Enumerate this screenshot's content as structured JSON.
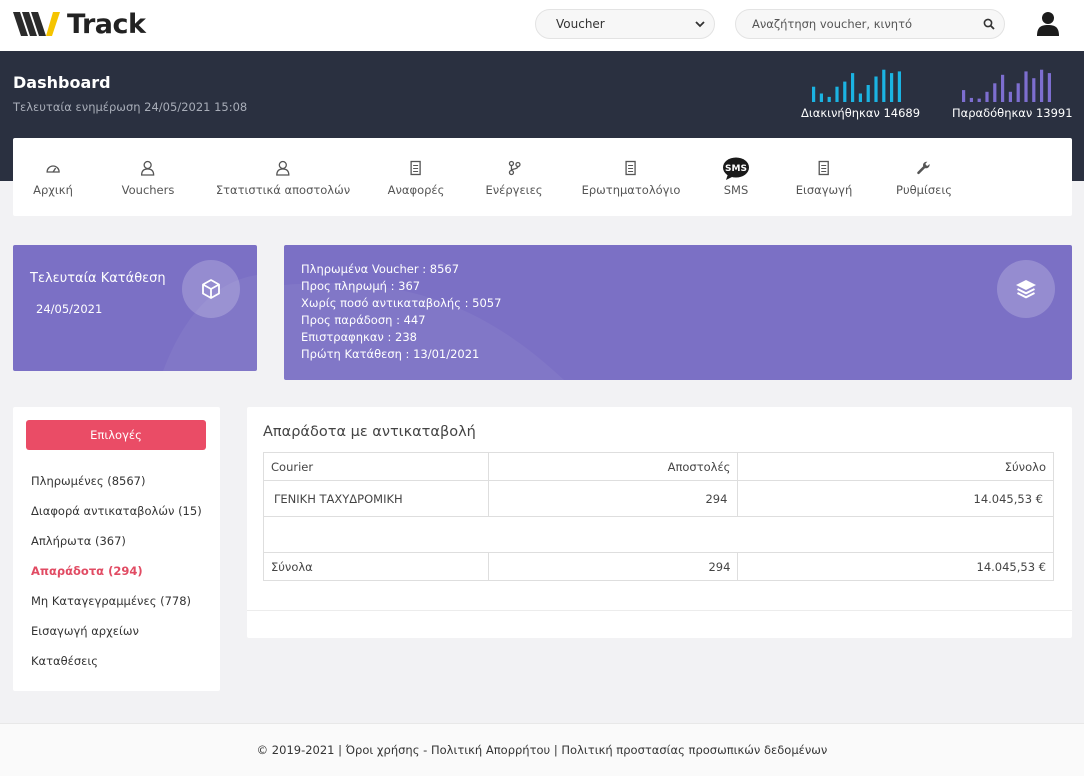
{
  "app": {
    "logo_text": "Track"
  },
  "topbar": {
    "voucher_select": "Voucher",
    "search_placeholder": "Αναζήτηση voucher, κινητό"
  },
  "header": {
    "title": "Dashboard",
    "subtitle": "Τελευταία ενημέρωση 24/05/2021 15:08",
    "moved": {
      "label": "Διακινήθηκαν",
      "value": "14689",
      "color": "#1bb3e2"
    },
    "delivered": {
      "label": "Παραδόθηκαν",
      "value": "13991",
      "color": "#7d6ed0"
    }
  },
  "nav": [
    {
      "label": "Αρχική",
      "icon": "home-icon"
    },
    {
      "label": "Vouchers",
      "icon": "user-icon"
    },
    {
      "label": "Στατιστικά αποστολών",
      "icon": "user-icon"
    },
    {
      "label": "Αναφορές",
      "icon": "receipt-icon"
    },
    {
      "label": "Ενέργειες",
      "icon": "branch-icon"
    },
    {
      "label": "Ερωτηματολόγιο",
      "icon": "receipt-icon"
    },
    {
      "label": "SMS",
      "icon": "sms-icon"
    },
    {
      "label": "Εισαγωγή",
      "icon": "receipt-icon"
    },
    {
      "label": "Ρυθμίσεις",
      "icon": "wrench-icon"
    }
  ],
  "deposit_card": {
    "title": "Τελευταία Κατάθεση",
    "date": "24/05/2021"
  },
  "stats_card": {
    "lines": [
      "Πληρωμένα Voucher : 8567",
      "Προς πληρωμή : 367",
      "Χωρίς ποσό αντικαταβολής : 5057",
      "Προς παράδοση : 447",
      "Επιστραφηκαν : 238",
      "Πρώτη Κατάθεση : 13/01/2021"
    ]
  },
  "options": {
    "button": "Επιλογές",
    "items": [
      {
        "label": "Πληρωμένες  (8567)",
        "active": false
      },
      {
        "label": "Διαφορά αντικαταβολών  (15)",
        "active": false
      },
      {
        "label": "Απλήρωτα  (367)",
        "active": false
      },
      {
        "label": "Απαράδοτα  (294)",
        "active": true
      },
      {
        "label": "Μη Καταγεγραμμένες  (778)",
        "active": false
      },
      {
        "label": "Εισαγωγή αρχείων",
        "active": false
      },
      {
        "label": "Καταθέσεις",
        "active": false
      }
    ]
  },
  "table": {
    "title": "Απαράδοτα με αντικαταβολή",
    "headers": [
      "Courier",
      "Αποστολές",
      "Σύνολο"
    ],
    "rows": [
      {
        "courier": "ΓΕΝΙΚΗ ΤΑΧΥΔΡΟΜΙΚΗ",
        "shipments": "294",
        "total": "14.045,53 €"
      }
    ],
    "footer": {
      "label": "Σύνολα",
      "shipments": "294",
      "total": "14.045,53 €"
    }
  },
  "footer": {
    "copyright": "© 2019-2021 | ",
    "terms": "Όροι χρήσης",
    "dash": " - ",
    "privacy": "Πολιτική Απορρήτου",
    "sep": " | ",
    "data_policy": "Πολιτική προστασίας προσωπικών δεδομένων"
  }
}
